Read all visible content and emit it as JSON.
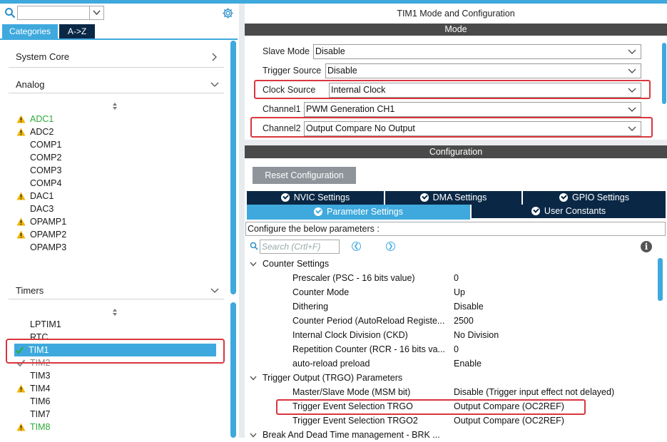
{
  "colors": {
    "accent": "#3fa9dd",
    "dark_tab": "#0a2846",
    "bar": "#4a4a4a",
    "highlight": "#d9363e",
    "warning": "#f0b400",
    "enabled": "#2eaa3a"
  },
  "left": {
    "search": {
      "value": "",
      "placeholder": ""
    },
    "tabs": [
      "Categories",
      "A->Z"
    ],
    "sections": [
      {
        "label": "System Core",
        "expanded": false
      },
      {
        "label": "Analog",
        "expanded": true
      },
      {
        "label": "Timers",
        "expanded": true
      }
    ],
    "analog_items": [
      {
        "label": "ADC1",
        "status": "warning-enabled"
      },
      {
        "label": "ADC2",
        "status": "warning"
      },
      {
        "label": "COMP1",
        "status": "none"
      },
      {
        "label": "COMP2",
        "status": "none"
      },
      {
        "label": "COMP3",
        "status": "none"
      },
      {
        "label": "COMP4",
        "status": "none"
      },
      {
        "label": "DAC1",
        "status": "warning"
      },
      {
        "label": "DAC3",
        "status": "none"
      },
      {
        "label": "OPAMP1",
        "status": "warning"
      },
      {
        "label": "OPAMP2",
        "status": "warning"
      },
      {
        "label": "OPAMP3",
        "status": "none"
      }
    ],
    "timer_items": [
      {
        "label": "LPTIM1",
        "status": "none"
      },
      {
        "label": "RTC",
        "status": "none"
      },
      {
        "label": "TIM1",
        "status": "selected"
      },
      {
        "label": "TIM2",
        "status": "check"
      },
      {
        "label": "TIM3",
        "status": "none"
      },
      {
        "label": "TIM4",
        "status": "warning"
      },
      {
        "label": "TIM6",
        "status": "none"
      },
      {
        "label": "TIM7",
        "status": "none"
      },
      {
        "label": "TIM8",
        "status": "warning-enabled"
      }
    ]
  },
  "right": {
    "title": "TIM1 Mode and Configuration",
    "mode_header": "Mode",
    "mode_rows": [
      {
        "label": "Slave Mode",
        "value": "Disable"
      },
      {
        "label": "Trigger Source",
        "value": "Disable"
      },
      {
        "label": "Clock Source",
        "value": "Internal Clock"
      },
      {
        "label": "Channel1",
        "value": "PWM Generation CH1"
      },
      {
        "label": "Channel2",
        "value": "Output Compare No Output"
      }
    ],
    "config_header": "Configuration",
    "reset_label": "Reset Configuration",
    "tabs_row1": [
      "NVIC Settings",
      "DMA Settings",
      "GPIO Settings"
    ],
    "tabs_row2": [
      "Parameter Settings",
      "User Constants"
    ],
    "description": "Configure the below parameters :",
    "param_search_placeholder": "Search (Crtl+F)",
    "groups": [
      {
        "label": "Counter Settings",
        "params": [
          {
            "name": "Prescaler (PSC - 16 bits value)",
            "value": "0"
          },
          {
            "name": "Counter Mode",
            "value": "Up"
          },
          {
            "name": "Dithering",
            "value": "Disable"
          },
          {
            "name": "Counter Period (AutoReload Registe...",
            "value": "2500"
          },
          {
            "name": "Internal Clock Division (CKD)",
            "value": "No Division"
          },
          {
            "name": "Repetition Counter (RCR - 16 bits va...",
            "value": "0"
          },
          {
            "name": "auto-reload preload",
            "value": "Enable"
          }
        ]
      },
      {
        "label": "Trigger Output (TRGO) Parameters",
        "params": [
          {
            "name": "Master/Slave Mode (MSM bit)",
            "value": "Disable (Trigger input effect not delayed)"
          },
          {
            "name": "Trigger Event Selection TRGO",
            "value": "Output Compare (OC2REF)"
          },
          {
            "name": "Trigger Event Selection TRGO2",
            "value": "Output Compare (OC2REF)"
          }
        ]
      },
      {
        "label": "Break And Dead Time management - BRK ...",
        "params": []
      }
    ]
  }
}
